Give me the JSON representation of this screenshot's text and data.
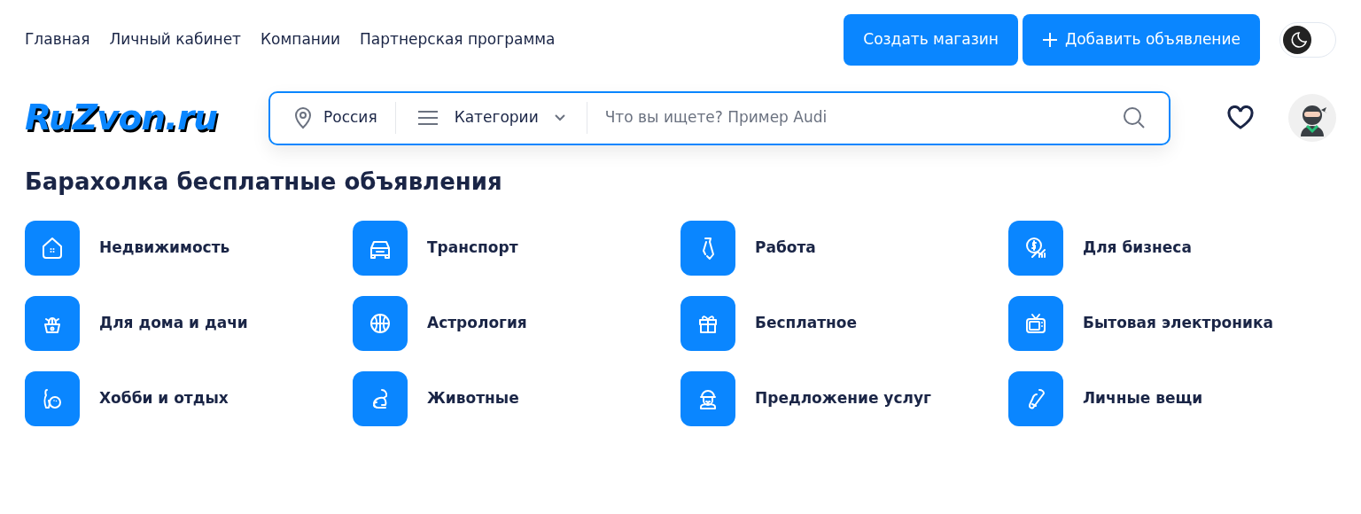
{
  "nav_links": [
    "Главная",
    "Личный кабинет",
    "Компании",
    "Партнерская программа"
  ],
  "buttons": [
    {
      "label": "Создать магазин",
      "kind": "plain"
    },
    {
      "label": "Добавить объявление",
      "kind": "add"
    }
  ],
  "dark_mode_toggle": {
    "on": false
  },
  "logo": "RuZvon.ru",
  "search": {
    "region": "Россия",
    "category": "Категории",
    "placeholder": "Что вы ищете? Пример Audi"
  },
  "heading": "Барахолка бесплатные объявления",
  "categories": [
    {
      "label": "Недвижимость"
    },
    {
      "label": "Транспорт"
    },
    {
      "label": "Работа"
    },
    {
      "label": "Для бизнеса"
    },
    {
      "label": "Для дома и дачи"
    },
    {
      "label": "Астрология"
    },
    {
      "label": "Бесплатное"
    },
    {
      "label": "Бытовая электроника"
    },
    {
      "label": "Хобби и отдых"
    },
    {
      "label": "Животные"
    },
    {
      "label": "Предложение услуг"
    },
    {
      "label": "Личные вещи"
    }
  ]
}
